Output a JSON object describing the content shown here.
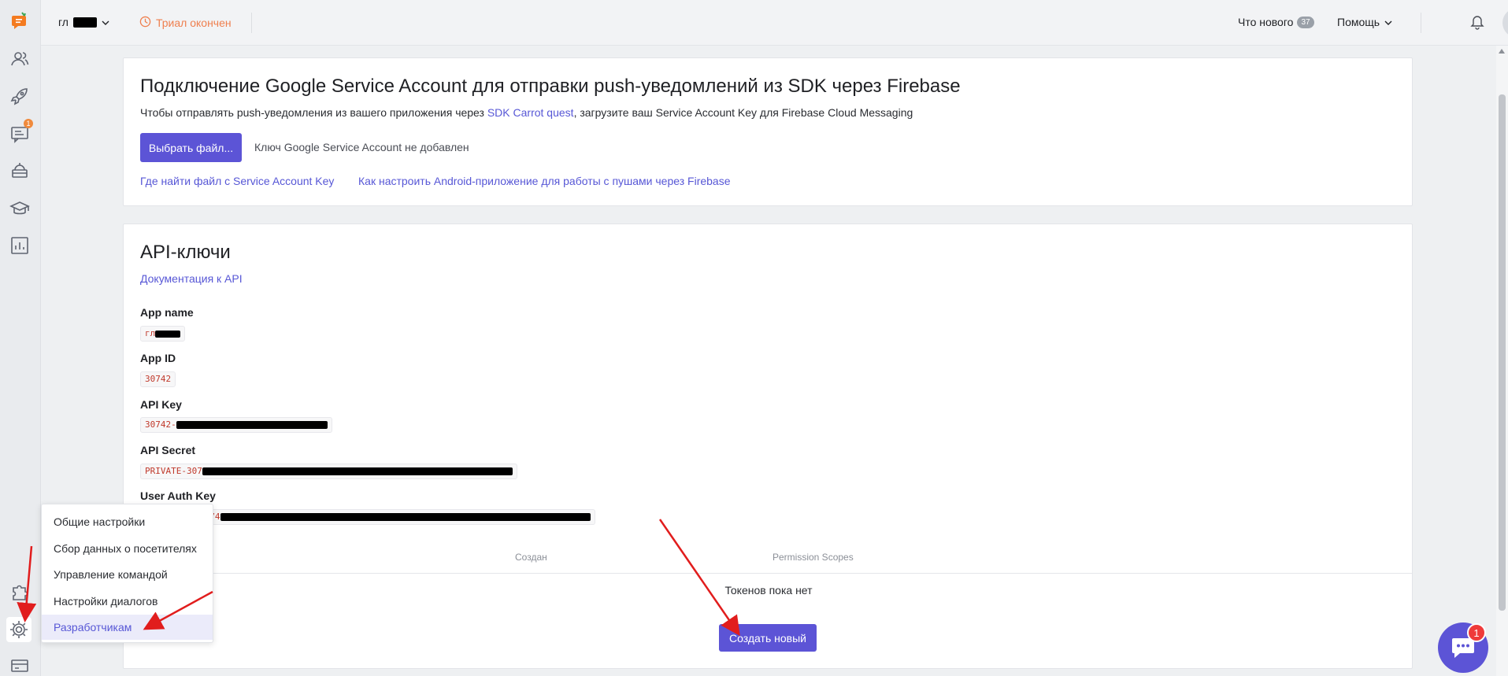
{
  "topbar": {
    "project_name": "гл",
    "trial_status": "Триал окончен",
    "whats_new_label": "Что нового",
    "whats_new_count": "37",
    "help_label": "Помощь"
  },
  "sidebar": {
    "conversations_badge": "1"
  },
  "firebase": {
    "title": "Подключение Google Service Account для отправки push-уведомлений из SDK через Firebase",
    "desc_before": "Чтобы отправлять push-уведомления из вашего приложения через ",
    "desc_link": "SDK Carrot quest",
    "desc_after": ", загрузите ваш Service Account Key для Firebase Cloud Messaging",
    "choose_file": "Выбрать файл...",
    "file_status": "Ключ Google Service Account не добавлен",
    "link_find_file": "Где найти файл с Service Account Key",
    "link_android_setup": "Как настроить Android-приложение для работы с пушами через Firebase"
  },
  "api": {
    "title": "API-ключи",
    "doc_link": "Документация к API",
    "app_name_label": "App name",
    "app_name_value": "гл",
    "app_id_label": "App ID",
    "app_id_value": "30742",
    "api_key_label": "API Key",
    "api_key_value": "30742-",
    "api_secret_label": "API Secret",
    "api_secret_value": "PRIVATE-307",
    "user_auth_label": "User Auth Key",
    "user_auth_value": "3074",
    "col_created": "Создан",
    "col_scopes": "Permission Scopes",
    "empty_text": "Токенов пока нет",
    "create_button": "Создать новый"
  },
  "settings_menu": {
    "items": [
      {
        "label": "Общие настройки"
      },
      {
        "label": "Сбор данных о посетителях"
      },
      {
        "label": "Управление командой"
      },
      {
        "label": "Настройки диалогов"
      },
      {
        "label": "Разработчикам"
      }
    ]
  },
  "chat_widget": {
    "badge": "1"
  },
  "colors": {
    "accent": "#5c54d6",
    "link": "#5757d6",
    "trial": "#ef7f4e",
    "annotation_arrow": "#e11d1d"
  }
}
